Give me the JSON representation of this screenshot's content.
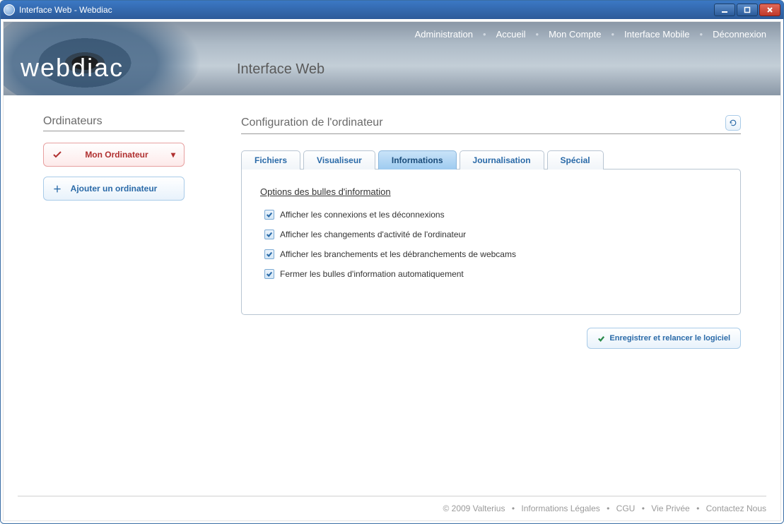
{
  "window": {
    "title": "Interface Web - Webdiac"
  },
  "banner": {
    "logo": "webdiac",
    "page_title": "Interface Web",
    "nav": {
      "admin": "Administration",
      "home": "Accueil",
      "account": "Mon Compte",
      "mobile": "Interface Mobile",
      "logout": "Déconnexion"
    }
  },
  "sidebar": {
    "heading": "Ordinateurs",
    "selected": {
      "label": "Mon Ordinateur"
    },
    "add": {
      "label": "Ajouter un ordinateur"
    }
  },
  "panel": {
    "heading": "Configuration de l'ordinateur",
    "tabs": {
      "files": "Fichiers",
      "viewer": "Visualiseur",
      "info": "Informations",
      "log": "Journalisation",
      "special": "Spécial"
    },
    "section_title": "Options des bulles d'information",
    "options": {
      "o1": {
        "label": "Afficher les connexions et les déconnexions",
        "checked": true
      },
      "o2": {
        "label": "Afficher les changements d'activité de l'ordinateur",
        "checked": true
      },
      "o3": {
        "label": "Afficher les branchements et les débranchements de webcams",
        "checked": true
      },
      "o4": {
        "label": "Fermer les bulles d'information automatiquement",
        "checked": true
      }
    },
    "save": "Enregistrer et relancer le logiciel"
  },
  "footer": {
    "copyright": "© 2009 Valterius",
    "legal": "Informations Légales",
    "cgu": "CGU",
    "privacy": "Vie Privée",
    "contact": "Contactez Nous"
  }
}
